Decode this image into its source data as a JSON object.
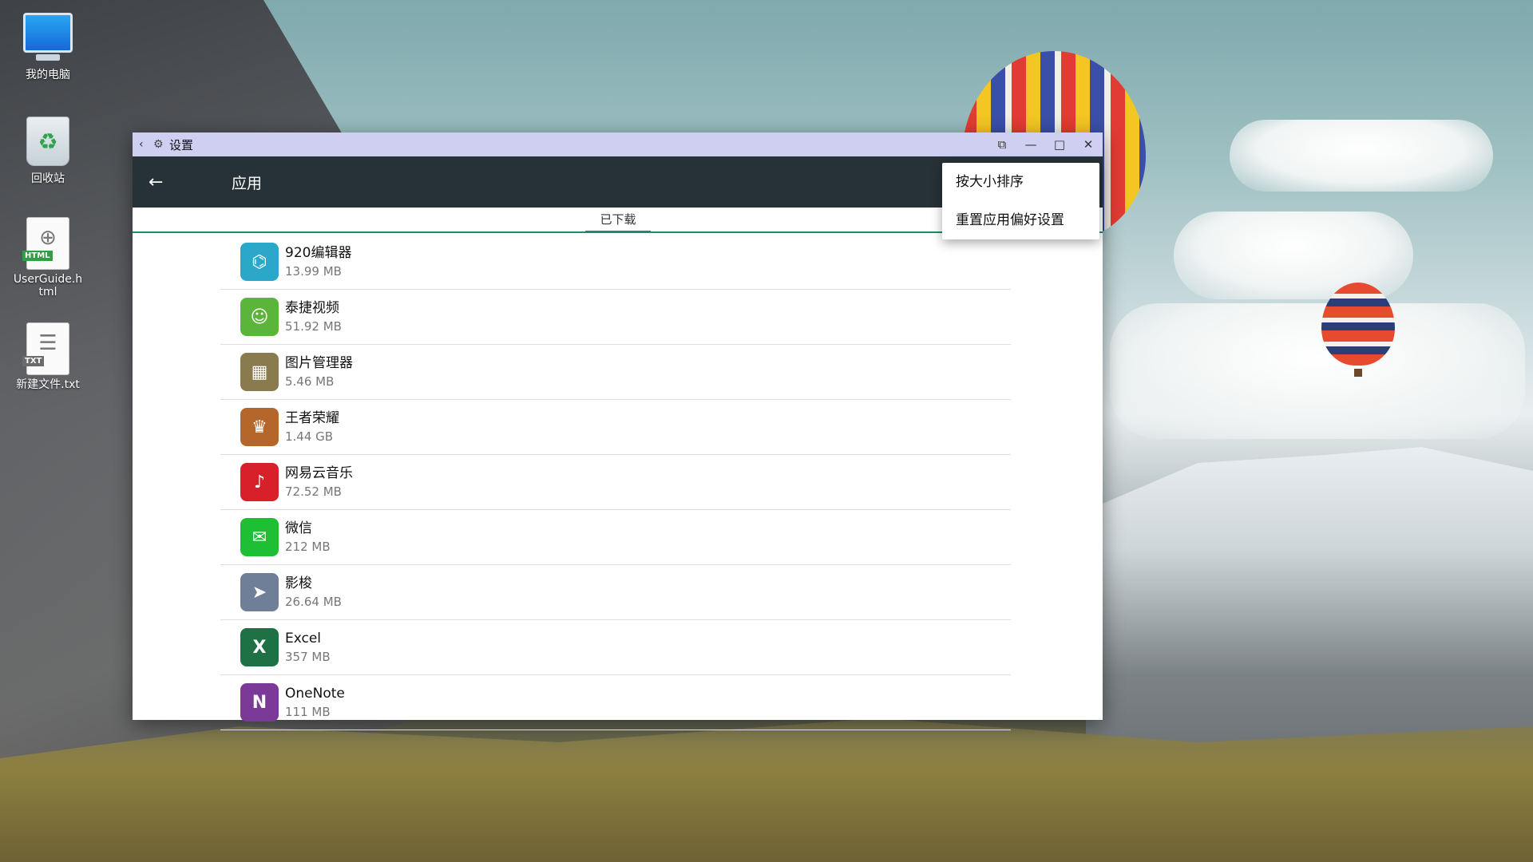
{
  "desktop": {
    "icons": [
      {
        "label": "我的电脑",
        "icon": "computer-icon"
      },
      {
        "label": "回收站",
        "icon": "recycle-bin-icon"
      },
      {
        "label": "UserGuide.h\ntml",
        "icon": "html-file-icon",
        "badge": "HTML"
      },
      {
        "label": "新建文件.txt",
        "icon": "txt-file-icon",
        "badge": "TXT"
      }
    ]
  },
  "window": {
    "title": "设置",
    "controls": [
      "screen-rotate-icon",
      "minimize-icon",
      "maximize-icon",
      "close-icon"
    ]
  },
  "appbar": {
    "title": "应用"
  },
  "tabs": [
    {
      "label": "已下载",
      "selected": true
    }
  ],
  "menu": {
    "items": [
      {
        "label": "按大小排序"
      },
      {
        "label": "重置应用偏好设置"
      }
    ]
  },
  "apps": [
    {
      "name": "920编辑器",
      "size": "13.99 MB",
      "icon": "editor-920-icon",
      "color": "#2aa7c9",
      "glyph": "⌬"
    },
    {
      "name": "泰捷视频",
      "size": "51.92 MB",
      "icon": "taijie-video-icon",
      "color": "#5bb53a",
      "glyph": "☺"
    },
    {
      "name": "图片管理器",
      "size": "5.46 MB",
      "icon": "photo-manager-icon",
      "color": "#8a7b4f",
      "glyph": "▦"
    },
    {
      "name": "王者荣耀",
      "size": "1.44 GB",
      "icon": "honor-of-kings-icon",
      "color": "#b4662b",
      "glyph": "♛"
    },
    {
      "name": "网易云音乐",
      "size": "72.52 MB",
      "icon": "netease-music-icon",
      "color": "#d8202a",
      "glyph": "♪"
    },
    {
      "name": "微信",
      "size": "212 MB",
      "icon": "wechat-icon",
      "color": "#1fbf35",
      "glyph": "✉"
    },
    {
      "name": "影梭",
      "size": "26.64 MB",
      "icon": "yingsuo-icon",
      "color": "#6f7f98",
      "glyph": "➤"
    },
    {
      "name": "Excel",
      "size": "357 MB",
      "icon": "excel-icon",
      "color": "#1e7145",
      "glyph": "X"
    },
    {
      "name": "OneNote",
      "size": "111 MB",
      "icon": "onenote-icon",
      "color": "#7c3a98",
      "glyph": "N"
    }
  ]
}
